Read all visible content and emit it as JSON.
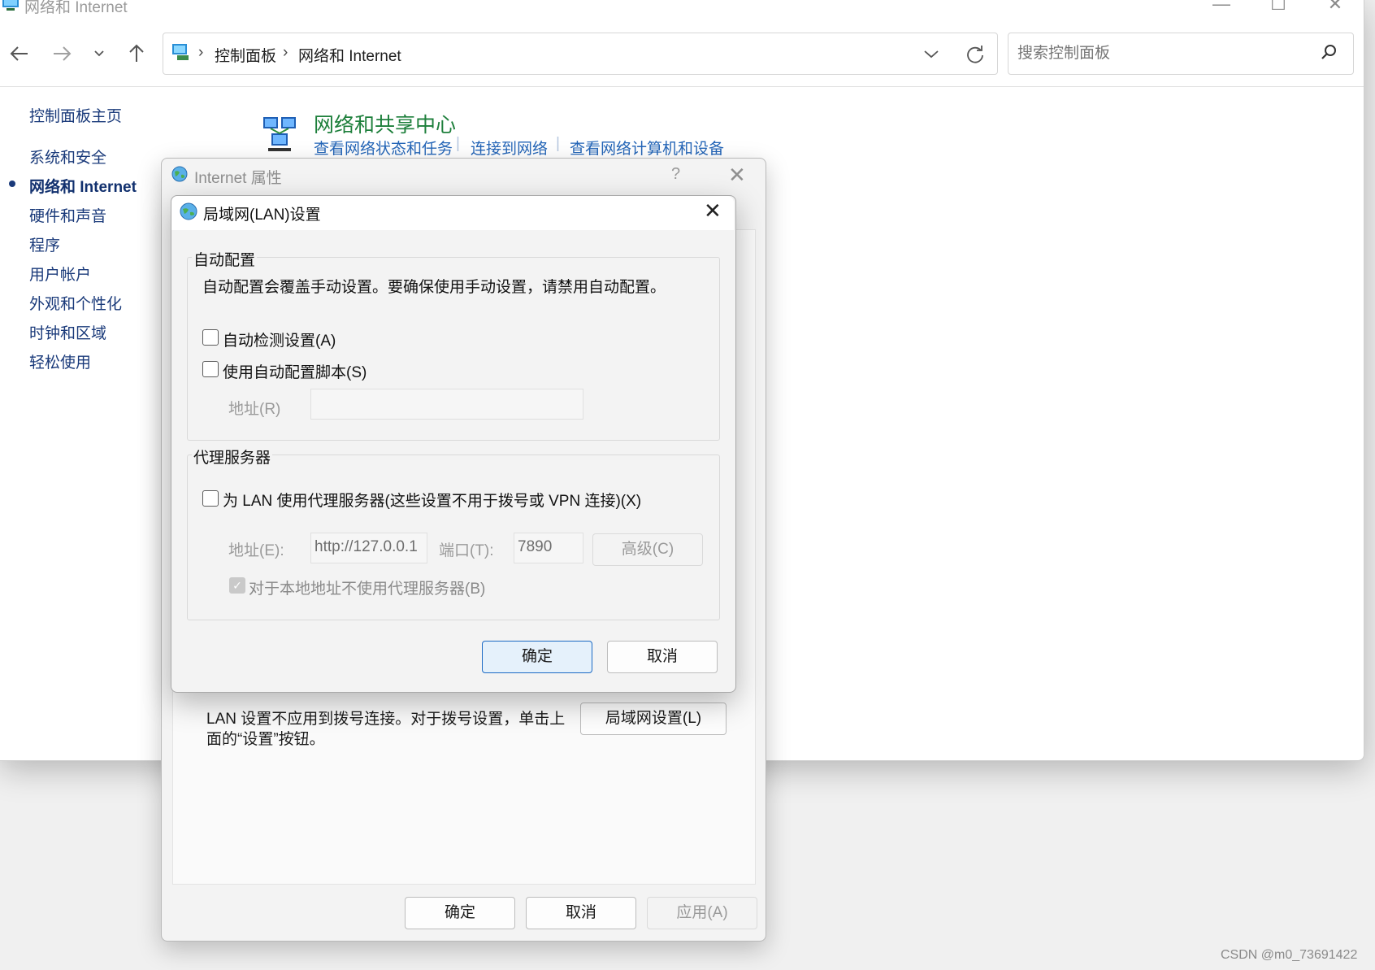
{
  "window": {
    "title": "网络和 Internet",
    "controls": [
      "minimize",
      "maximize",
      "close"
    ]
  },
  "toolbar": {
    "back_icon": "back-arrow-icon",
    "forward_icon": "forward-arrow-icon",
    "history_icon": "chevron-down-icon",
    "up_icon": "up-arrow-icon",
    "breadcrumbs": [
      "控制面板",
      "网络和 Internet"
    ],
    "search_placeholder": "搜索控制面板"
  },
  "sidebar": {
    "items": [
      {
        "label": "控制面板主页",
        "active": false
      },
      {
        "label": "系统和安全",
        "active": false
      },
      {
        "label": "网络和 Internet",
        "active": true
      },
      {
        "label": "硬件和声音",
        "active": false
      },
      {
        "label": "程序",
        "active": false
      },
      {
        "label": "用户帐户",
        "active": false
      },
      {
        "label": "外观和个性化",
        "active": false
      },
      {
        "label": "时钟和区域",
        "active": false
      },
      {
        "label": "轻松使用",
        "active": false
      }
    ]
  },
  "network_center": {
    "heading": "网络和共享中心",
    "links": [
      "查看网络状态和任务",
      "连接到网络",
      "查看网络计算机和设备"
    ]
  },
  "internet_properties": {
    "title": "Internet 属性",
    "help": "?",
    "lan_note": "LAN 设置不应用到拨号连接。对于拨号设置，单击上面的“设置”按钮。",
    "lan_settings_button": "局域网设置(L)",
    "ok": "确定",
    "cancel": "取消",
    "apply": "应用(A)"
  },
  "lan_dialog": {
    "title": "局域网(LAN)设置",
    "auto_group": {
      "label": "自动配置",
      "description": "自动配置会覆盖手动设置。要确保使用手动设置，请禁用自动配置。",
      "auto_detect": {
        "label": "自动检测设置(A)",
        "checked": false
      },
      "use_script": {
        "label": "使用自动配置脚本(S)",
        "checked": false
      },
      "address_label": "地址(R)",
      "address_value": ""
    },
    "proxy_group": {
      "label": "代理服务器",
      "use_proxy": {
        "label": "为 LAN 使用代理服务器(这些设置不用于拨号或 VPN 连接)(X)",
        "checked": false
      },
      "address_label": "地址(E):",
      "address_value": "http://127.0.0.1",
      "port_label": "端口(T):",
      "port_value": "7890",
      "advanced_button": "高级(C)",
      "bypass_local": {
        "label": "对于本地地址不使用代理服务器(B)",
        "checked": true,
        "disabled": true
      }
    },
    "ok": "确定",
    "cancel": "取消"
  },
  "watermark": "CSDN @m0_73691422",
  "colors": {
    "link": "#2566b8",
    "heading_green": "#1d7f3b",
    "accent": "#1b6ac4"
  }
}
